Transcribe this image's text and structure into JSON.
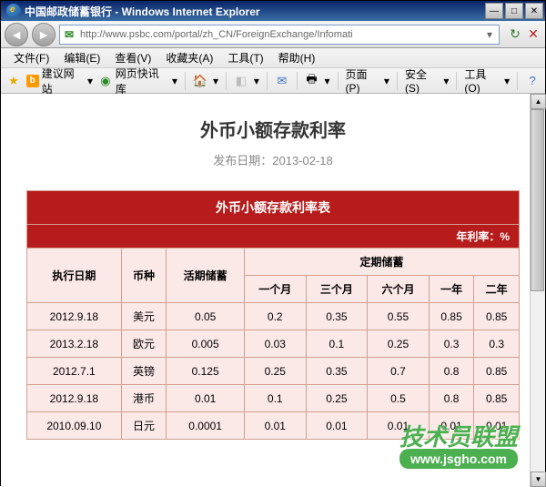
{
  "window": {
    "title": "中国邮政储蓄银行 - Windows Internet Explorer",
    "url": "http://www.psbc.com/portal/zh_CN/ForeignExchange/Infomati"
  },
  "menu": {
    "file": "文件(F)",
    "edit": "编辑(E)",
    "view": "查看(V)",
    "favorites": "收藏夹(A)",
    "tools": "工具(T)",
    "help": "帮助(H)"
  },
  "toolbar": {
    "suggested": "建议网站",
    "webslice": "网页快讯库",
    "page": "页面(P)",
    "safety": "安全(S)",
    "tools": "工具(O)"
  },
  "page": {
    "title": "外币小额存款利率",
    "date_label": "发布日期：",
    "date": "2013-02-18",
    "table_title": "外币小额存款利率表",
    "unit_label": "年利率：%",
    "headers": {
      "exec_date": "执行日期",
      "currency": "币种",
      "demand": "活期储蓄",
      "fixed": "定期储蓄",
      "m1": "一个月",
      "m3": "三个月",
      "m6": "六个月",
      "y1": "一年",
      "y2": "二年"
    },
    "rows": [
      {
        "date": "2012.9.18",
        "currency": "美元",
        "demand": "0.05",
        "m1": "0.2",
        "m3": "0.35",
        "m6": "0.55",
        "y1": "0.85",
        "y2": "0.85"
      },
      {
        "date": "2013.2.18",
        "currency": "欧元",
        "demand": "0.005",
        "m1": "0.03",
        "m3": "0.1",
        "m6": "0.25",
        "y1": "0.3",
        "y2": "0.3"
      },
      {
        "date": "2012.7.1",
        "currency": "英镑",
        "demand": "0.125",
        "m1": "0.25",
        "m3": "0.35",
        "m6": "0.7",
        "y1": "0.8",
        "y2": "0.85"
      },
      {
        "date": "2012.9.18",
        "currency": "港币",
        "demand": "0.01",
        "m1": "0.1",
        "m3": "0.25",
        "m6": "0.5",
        "y1": "0.8",
        "y2": "0.85"
      },
      {
        "date": "2010.09.10",
        "currency": "日元",
        "demand": "0.0001",
        "m1": "0.01",
        "m3": "0.01",
        "m6": "0.01",
        "y1": "0.01",
        "y2": "0.01"
      }
    ]
  },
  "watermark": {
    "text1": "技术员联盟",
    "text2": "www.jsgho.com"
  }
}
